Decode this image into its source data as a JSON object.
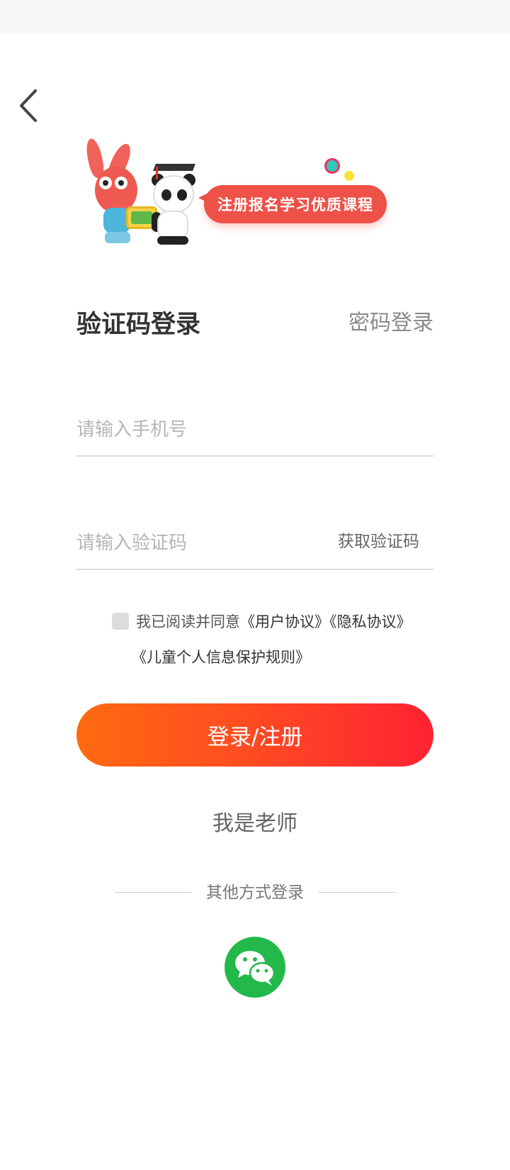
{
  "hero": {
    "banner_text": "注册报名学习优质课程"
  },
  "login": {
    "title": "验证码登录",
    "switch_label": "密码登录"
  },
  "form": {
    "phone_placeholder": "请输入手机号",
    "code_placeholder": "请输入验证码",
    "get_code_label": "获取验证码"
  },
  "agreement": {
    "prefix": "我已阅读并同意",
    "user_agreement": "《用户协议》",
    "privacy_agreement": "《隐私协议》",
    "child_rules": "《儿童个人信息保护规则》"
  },
  "actions": {
    "submit_label": "登录/注册",
    "teacher_label": "我是老师"
  },
  "other_login": {
    "label": "其他方式登录",
    "wechat_icon": "wechat-icon"
  },
  "colors": {
    "accent_start": "#ff6a10",
    "accent_end": "#ff2233",
    "wechat_green": "#22b94a",
    "banner_red": "#ee5148"
  }
}
